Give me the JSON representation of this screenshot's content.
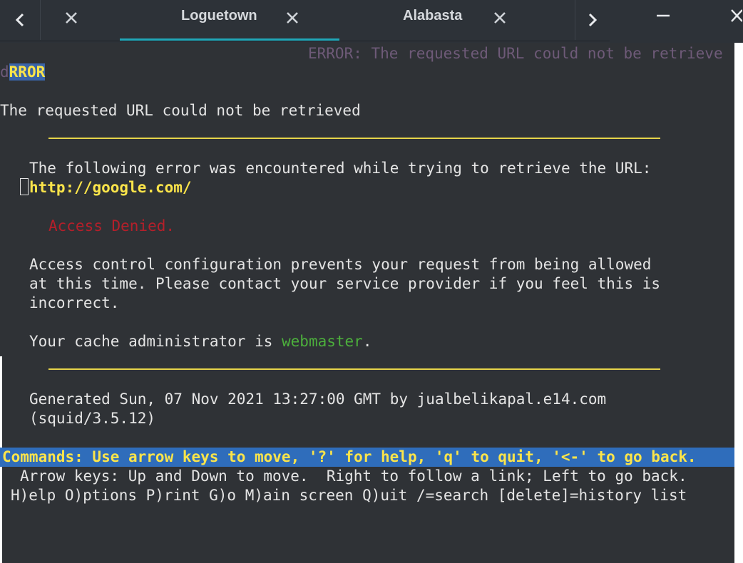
{
  "window": {
    "back_glyph": "‹",
    "forward_glyph": "›",
    "minimize_glyph": "—",
    "close_glyph": "✕",
    "tabs": [
      {
        "title": "",
        "close_glyph": "✕"
      },
      {
        "title": "Loguetown",
        "close_glyph": "✕",
        "active": true
      },
      {
        "title": "Alabasta",
        "close_glyph": "✕"
      }
    ],
    "accent_color": "#20a7b8"
  },
  "terminal": {
    "title_bar": "ERROR: The requested URL could not be retrieve",
    "heading_prefix": "d",
    "heading_highlight": "RROR",
    "subtitle": "The requested URL could not be retrieved",
    "intro": "The following error was encountered while trying to retrieve the URL:",
    "url": "http://google.com/",
    "error": "Access Denied.",
    "explain": [
      "Access control configuration prevents your request from being allowed",
      "at this time. Please contact your service provider if you feel this is",
      "incorrect."
    ],
    "admin_prefix": "Your cache administrator is ",
    "admin_link": "webmaster",
    "admin_suffix": ".",
    "generated": [
      "Generated Sun, 07 Nov 2021 13:27:00 GMT by jualbelikapal.e14.com",
      "(squid/3.5.12)"
    ],
    "commands": "Commands: Use arrow keys to move, '?' for help, 'q' to quit, '<-' to go back.",
    "help_lines": [
      "Arrow keys: Up and Down to move.  Right to follow a link; Left to go back.",
      "H)elp O)ptions P)rint G)o M)ain screen Q)uit /=search [delete]=history list"
    ],
    "colors": {
      "background": "#2f3236",
      "link": "#fbe44a",
      "error": "#b51f2a",
      "admin_link": "#4caf3c",
      "status_bar": "#2f6dbb"
    }
  }
}
